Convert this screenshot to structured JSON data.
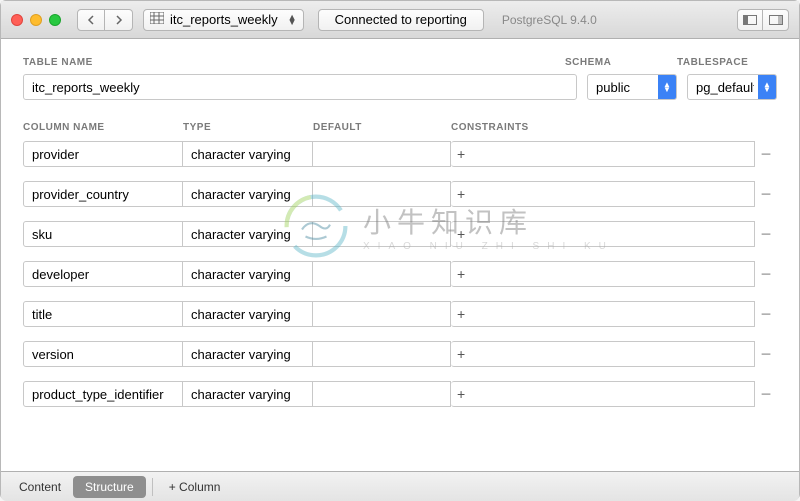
{
  "toolbar": {
    "table_selector": "itc_reports_weekly",
    "connection": "Connected to reporting",
    "db_version": "PostgreSQL 9.4.0"
  },
  "form": {
    "table_name_label": "TABLE NAME",
    "schema_label": "SCHEMA",
    "tablespace_label": "TABLESPACE",
    "table_name": "itc_reports_weekly",
    "schema": "public",
    "tablespace": "pg_default"
  },
  "col_headers": {
    "name": "COLUMN NAME",
    "type": "TYPE",
    "default": "DEFAULT",
    "constraints": "CONSTRAINTS"
  },
  "columns": [
    {
      "name": "provider",
      "type": "character varying",
      "default": "",
      "constraints": ""
    },
    {
      "name": "provider_country",
      "type": "character varying",
      "default": "",
      "constraints": ""
    },
    {
      "name": "sku",
      "type": "character varying",
      "default": "",
      "constraints": ""
    },
    {
      "name": "developer",
      "type": "character varying",
      "default": "",
      "constraints": ""
    },
    {
      "name": "title",
      "type": "character varying",
      "default": "",
      "constraints": ""
    },
    {
      "name": "version",
      "type": "character varying",
      "default": "",
      "constraints": ""
    },
    {
      "name": "product_type_identifier",
      "type": "character varying",
      "default": "",
      "constraints": ""
    }
  ],
  "bottom": {
    "content": "Content",
    "structure": "Structure",
    "add_column": "+ Column"
  },
  "watermark": {
    "main": "小牛知识库",
    "sub": "XIAO NIU ZHI SHI KU"
  }
}
